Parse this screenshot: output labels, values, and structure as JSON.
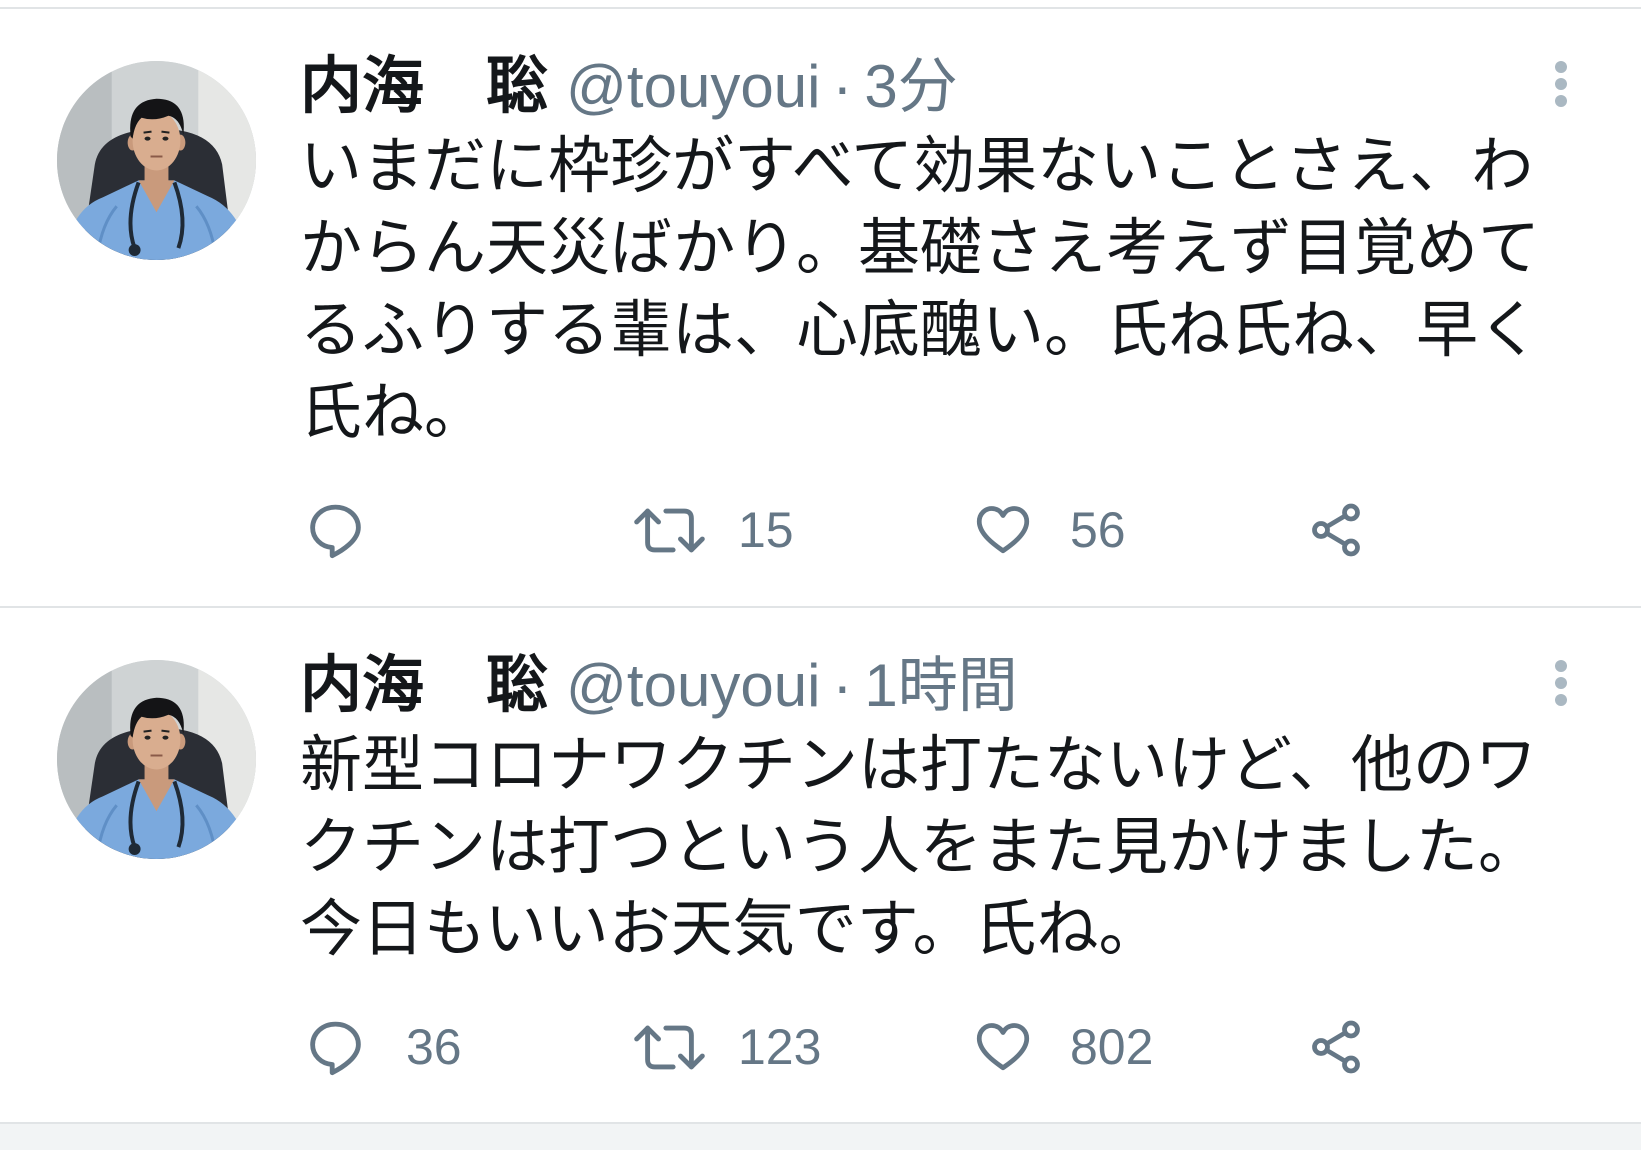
{
  "colors": {
    "text": "#14171a",
    "secondary": "#657786",
    "border": "#e1e4e6",
    "menu_dots": "#aab8c2",
    "footer": "#f2f4f5"
  },
  "icons": {
    "reply": "reply-icon",
    "retweet": "retweet-icon",
    "like": "heart-icon",
    "share": "share-icon",
    "more": "more-vertical-icon"
  },
  "tweets": [
    {
      "author": {
        "name": "内海　聡",
        "handle": "@touyoui"
      },
      "separator": "·",
      "time": "3分",
      "text_lines": [
        "いまだに枠珍がすべて効果ないことさえ、わ",
        "からん天災ばかり。基礎さえ考えず目覚めて",
        "るふりする輩は、心底醜い。氏ね氏ね、早く",
        "氏ね。"
      ],
      "counts": {
        "retweets": "15",
        "likes": "56"
      }
    },
    {
      "author": {
        "name": "内海　聡",
        "handle": "@touyoui"
      },
      "separator": "·",
      "time": "1時間",
      "text_lines": [
        "新型コロナワクチンは打たないけど、他のワ",
        "クチンは打つという人をまた見かけました。",
        "今日もいいお天気です。氏ね。"
      ],
      "counts": {
        "replies": "36",
        "retweets": "123",
        "likes": "802"
      }
    }
  ]
}
